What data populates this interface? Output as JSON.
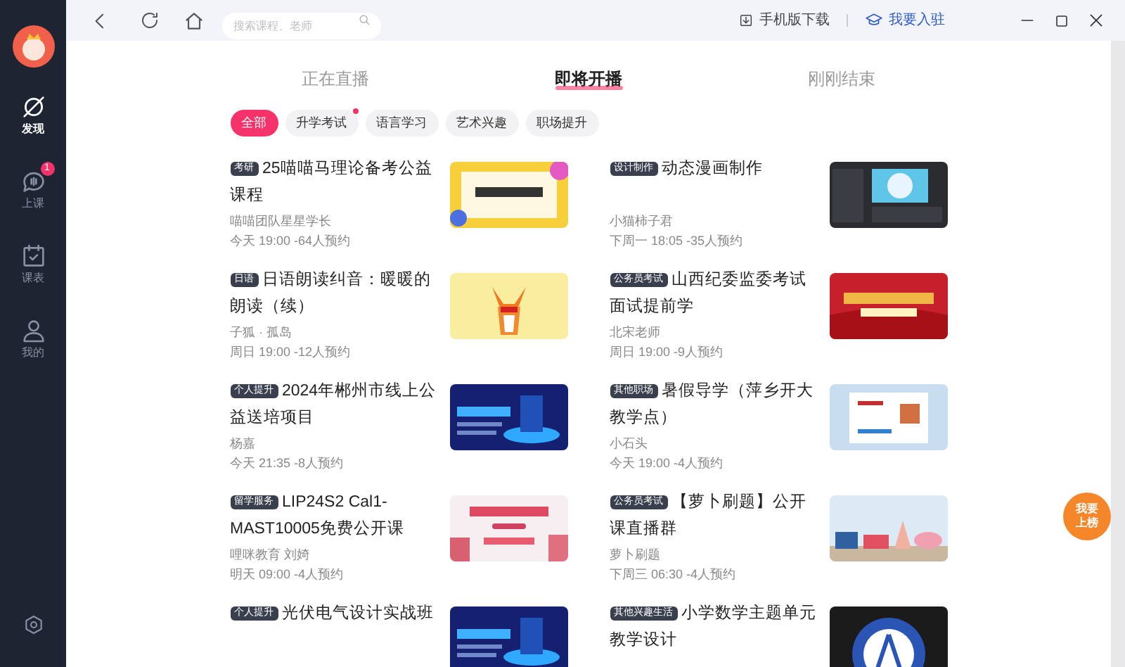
{
  "sidebar": {
    "items": [
      {
        "kind": "discover",
        "label": "发现",
        "selected": true
      },
      {
        "kind": "class",
        "label": "上课",
        "selected": false,
        "badge": "1"
      },
      {
        "kind": "schedule",
        "label": "课表",
        "selected": false
      },
      {
        "kind": "me",
        "label": "我的",
        "selected": false
      }
    ]
  },
  "toolbar": {
    "search": {
      "placeholder": "搜索课程、老师"
    },
    "download": "手机版下载",
    "join": "我要入驻"
  },
  "tabs": [
    {
      "label": "正在直播",
      "selected": false
    },
    {
      "label": "即将开播",
      "selected": true
    },
    {
      "label": "刚刚结束",
      "selected": false
    }
  ],
  "filters": [
    {
      "label": "全部",
      "selected": true,
      "dot": false
    },
    {
      "label": "升学考试",
      "selected": false,
      "dot": true
    },
    {
      "label": "语言学习",
      "selected": false,
      "dot": false
    },
    {
      "label": "艺术兴趣",
      "selected": false,
      "dot": false
    },
    {
      "label": "职场提升",
      "selected": false,
      "dot": false
    }
  ],
  "courses": [
    {
      "tag": "考研",
      "title": "25喵喵马理论备考公益课程",
      "teacher": "喵喵团队星星学长",
      "time": "今天 19:00 -64人预约"
    },
    {
      "tag": "设计制作",
      "title": "动态漫画制作",
      "teacher": "小猫柿子君",
      "time": "下周一 18:05 -35人预约"
    },
    {
      "tag": "日语",
      "title": "日语朗读纠音：暖暖的朗读（续）",
      "teacher": "子狐 · 孤岛",
      "time": "周日 19:00 -12人预约"
    },
    {
      "tag": "公务员考试",
      "title": "山西纪委监委考试面试提前学",
      "teacher": "北宋老师",
      "time": "周日 19:00 -9人预约"
    },
    {
      "tag": "个人提升",
      "title": "2024年郴州市线上公益送培项目",
      "teacher": "杨嘉",
      "time": "今天 21:35 -8人预约"
    },
    {
      "tag": "其他职场",
      "title": "暑假导学（萍乡开大教学点）",
      "teacher": "小石头",
      "time": "今天 19:00 -4人预约"
    },
    {
      "tag": "留学服务",
      "title": "LIP24S2 Cal1-MAST10005免费公开课",
      "teacher": "哩咪教育 刘婍",
      "time": "明天 09:00 -4人预约"
    },
    {
      "tag": "公务员考试",
      "title": "【萝卜刷题】公开课直播群",
      "teacher": "萝卜刷题",
      "time": "下周三 06:30 -4人预约"
    },
    {
      "tag": "个人提升",
      "title": "光伏电气设计实战班"
    },
    {
      "tag": "其他兴趣生活",
      "title": "小学数学主题单元教学设计"
    }
  ],
  "float_badge": "我要上榜"
}
